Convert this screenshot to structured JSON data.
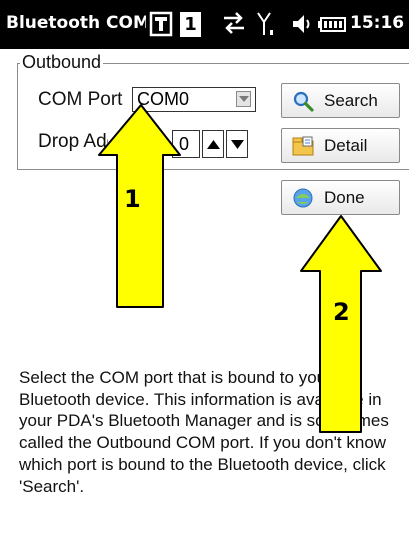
{
  "titlebar": {
    "title": "Bluetooth COM Port",
    "page_indicator": "1",
    "time": "15:16"
  },
  "outbound": {
    "group_label": "Outbound",
    "com_port": {
      "label": "COM Port",
      "value": "COM0"
    },
    "drop": {
      "label": "Drop Address",
      "value": "0"
    }
  },
  "buttons": {
    "search": "Search",
    "detail": "Detail",
    "done": "Done"
  },
  "annotations": {
    "arrow1_label": "1",
    "arrow2_label": "2",
    "arrow_color": "#ffff00"
  },
  "description": "Select the COM port that is bound to your Bluetooth device. This information is available in your PDA's Bluetooth Manager and is sometimes called the Outbound COM port. If you don't know which port is bound to the Bluetooth device, click 'Search'."
}
